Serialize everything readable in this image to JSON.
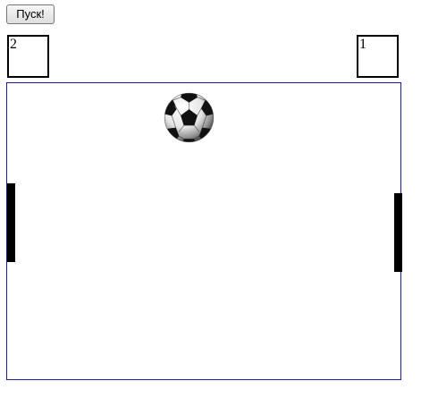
{
  "controls": {
    "start_label": "Пуск!"
  },
  "scores": {
    "left": "2",
    "right": "1"
  },
  "colors": {
    "field_border": "#1a1aa8",
    "paddle": "#000000",
    "background": "#ffffff"
  },
  "icons": {
    "ball": "soccer-ball-icon"
  }
}
